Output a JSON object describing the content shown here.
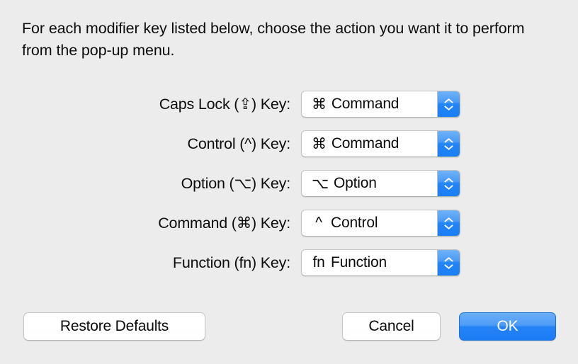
{
  "dialog": {
    "instruction": "For each modifier key listed below, choose the action you want it to perform from the pop-up menu."
  },
  "rows": [
    {
      "label": "Caps Lock (⇪) Key:",
      "key_name": "Caps Lock",
      "key_symbol": "⇪",
      "selected": {
        "glyph": "⌘",
        "text": "Command"
      }
    },
    {
      "label": "Control (^) Key:",
      "key_name": "Control",
      "key_symbol": "^",
      "selected": {
        "glyph": "⌘",
        "text": "Command"
      }
    },
    {
      "label": "Option (⌥) Key:",
      "key_name": "Option",
      "key_symbol": "⌥",
      "selected": {
        "glyph": "⌥",
        "text": "Option"
      }
    },
    {
      "label": "Command (⌘) Key:",
      "key_name": "Command",
      "key_symbol": "⌘",
      "selected": {
        "glyph": "^",
        "text": "Control"
      }
    },
    {
      "label": "Function (fn) Key:",
      "key_name": "Function",
      "key_symbol": "fn",
      "selected": {
        "glyph": "fn",
        "text": "Function"
      }
    }
  ],
  "buttons": {
    "restore_defaults": "Restore Defaults",
    "cancel": "Cancel",
    "ok": "OK"
  },
  "colors": {
    "background": "#ececec",
    "accent_blue": "#1a7cf5",
    "stepper_blue": "#2186f7",
    "text": "#0d0d0d"
  }
}
